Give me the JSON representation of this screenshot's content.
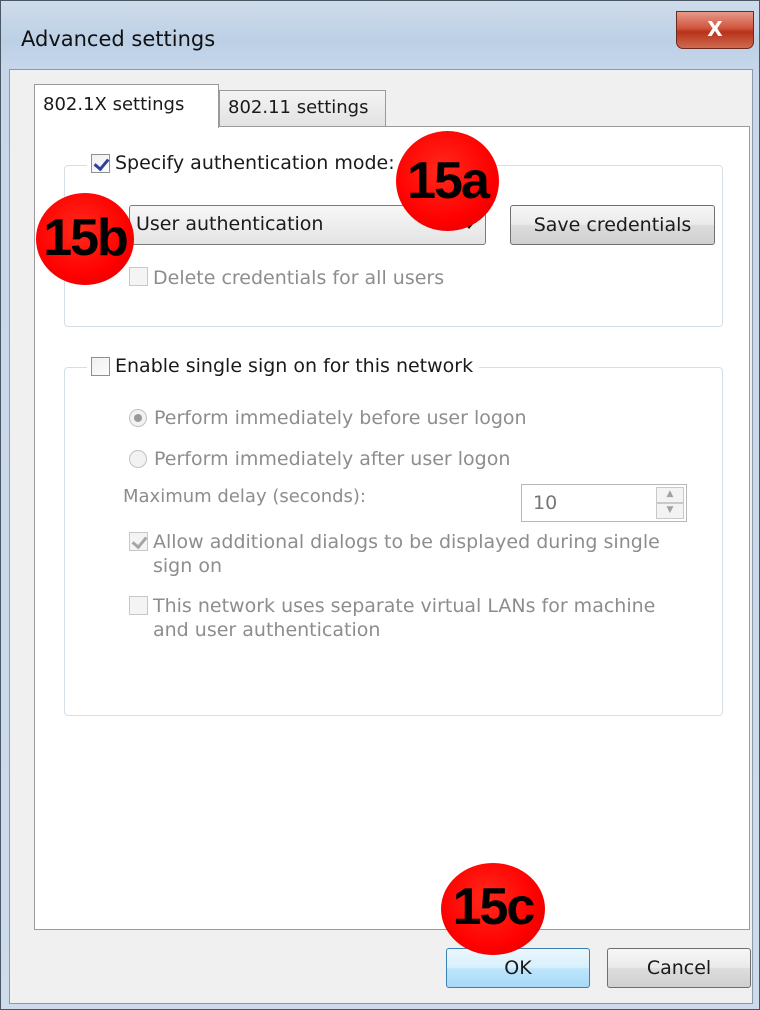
{
  "window": {
    "title": "Advanced settings",
    "close_label": "X"
  },
  "tabs": [
    {
      "label": "802.1X settings",
      "selected": true
    },
    {
      "label": "802.11 settings",
      "selected": false
    }
  ],
  "auth_group": {
    "specify_mode_label": "Specify authentication mode:",
    "specify_mode_checked": true,
    "mode_selected": "User authentication",
    "save_credentials_label": "Save credentials",
    "delete_credentials_label": "Delete credentials for all users",
    "delete_credentials_checked": false
  },
  "sso_group": {
    "enable_label": "Enable single sign on for this network",
    "enable_checked": false,
    "radio_before_label": "Perform immediately before user logon",
    "radio_after_label": "Perform immediately after user logon",
    "max_delay_label": "Maximum delay (seconds):",
    "max_delay_value": "10",
    "allow_dialogs_label_line1": "Allow additional dialogs to be displayed during single",
    "allow_dialogs_label_line2": "sign on",
    "allow_dialogs_checked": true,
    "separate_vlans_label_line1": "This network uses separate virtual LANs for machine",
    "separate_vlans_label_line2": "and user authentication",
    "separate_vlans_checked": false
  },
  "footer": {
    "ok_label": "OK",
    "cancel_label": "Cancel"
  },
  "annotations": {
    "a": "15a",
    "b": "15b",
    "c": "15c",
    "color": "#ff0000"
  }
}
